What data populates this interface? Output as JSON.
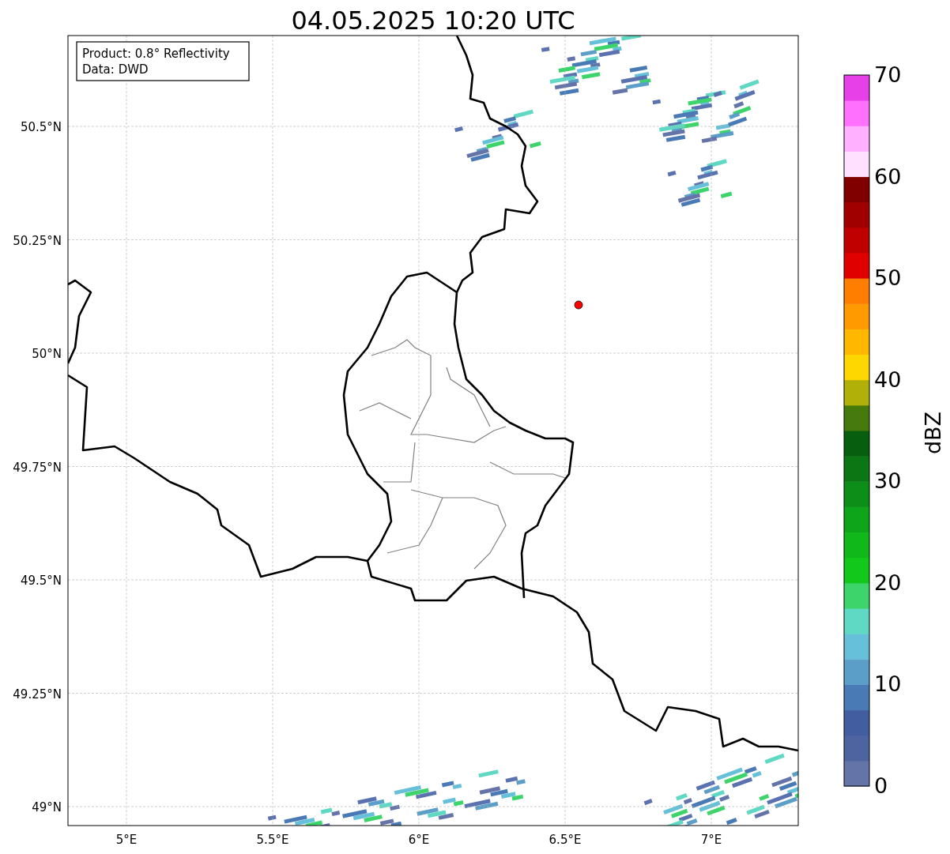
{
  "title": "04.05.2025 10:20 UTC",
  "info_box": [
    "Product: 0.8° Reflectivity",
    "Data: DWD"
  ],
  "map": {
    "lat_ticks": [
      "50.5°N",
      "50.25°N",
      "50°N",
      "49.75°N",
      "49.5°N",
      "49.25°N",
      "49°N"
    ],
    "lon_ticks": [
      "5°E",
      "5.5°E",
      "6°E",
      "6.5°E",
      "7°E"
    ]
  },
  "colorbar": {
    "label": "dBZ",
    "ticks": [
      "70",
      "60",
      "50",
      "40",
      "30",
      "20",
      "10",
      "0"
    ]
  }
}
